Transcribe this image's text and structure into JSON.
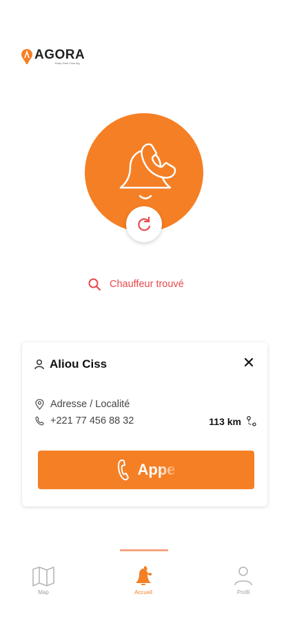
{
  "brand": {
    "name": "AGORA",
    "tagline": "Keep Zone Tous ing"
  },
  "status": {
    "label": "Chauffeur trouvé"
  },
  "card": {
    "driver_name": "Aliou Ciss",
    "address": "Adresse / Localité",
    "phone": "+221 77 456 88 32",
    "distance": "113 km",
    "call_label": "Appe"
  },
  "nav": {
    "items": [
      {
        "label": "Map",
        "icon": "map-icon"
      },
      {
        "label": "Accueil",
        "icon": "bell-phone-icon"
      },
      {
        "label": "Profil",
        "icon": "user-icon"
      }
    ],
    "active_index": 1
  },
  "colors": {
    "accent": "#f57f25",
    "status": "#e8484b"
  }
}
